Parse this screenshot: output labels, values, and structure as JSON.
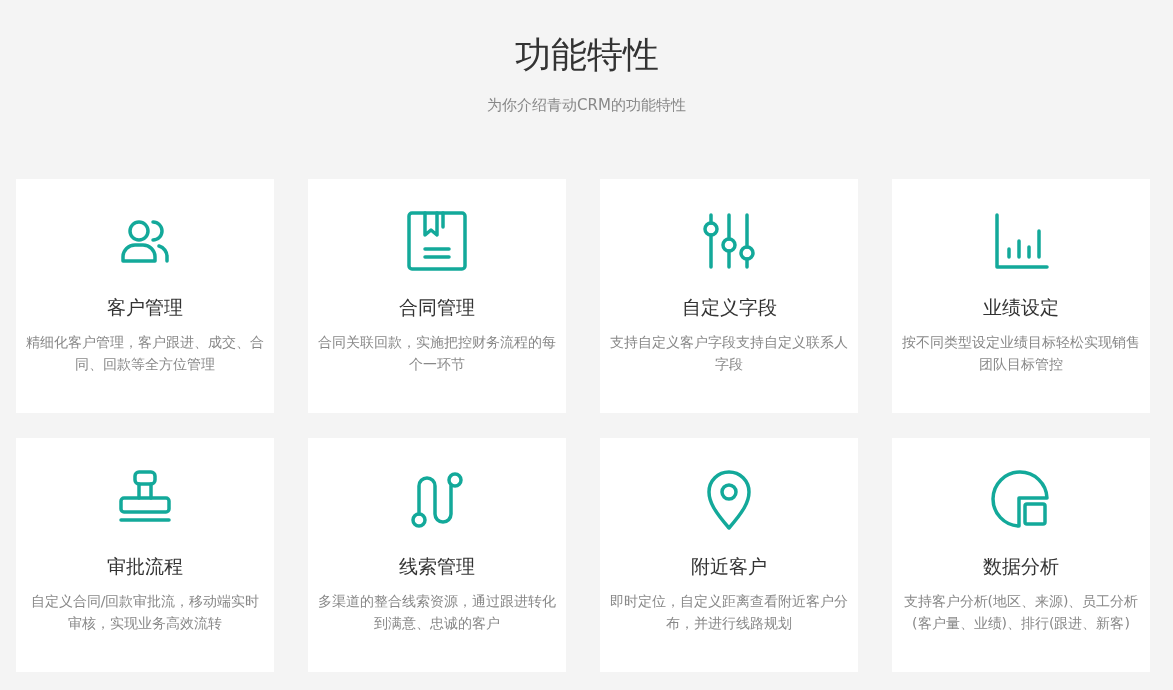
{
  "heading": {
    "title": "功能特性",
    "subtitle": "为你介绍青动CRM的功能特性"
  },
  "features": [
    {
      "title": "客户管理",
      "description": "精细化客户管理，客户跟进、成交、合同、回款等全方位管理"
    },
    {
      "title": "合同管理",
      "description": "合同关联回款，实施把控财务流程的每个一环节"
    },
    {
      "title": "自定义字段",
      "description": "支持自定义客户字段支持自定义联系人字段"
    },
    {
      "title": "业绩设定",
      "description": "按不同类型设定业绩目标轻松实现销售团队目标管控"
    },
    {
      "title": "审批流程",
      "description": "自定义合同/回款审批流，移动端实时审核，实现业务高效流转"
    },
    {
      "title": "线索管理",
      "description": "多渠道的整合线索资源，通过跟进转化到满意、忠诚的客户"
    },
    {
      "title": "附近客户",
      "description": "即时定位，自定义距离查看附近客户分布，并进行线路规划"
    },
    {
      "title": "数据分析",
      "description": "支持客户分析(地区、来源)、员工分析(客户量、业绩)、排行(跟进、新客)"
    }
  ]
}
